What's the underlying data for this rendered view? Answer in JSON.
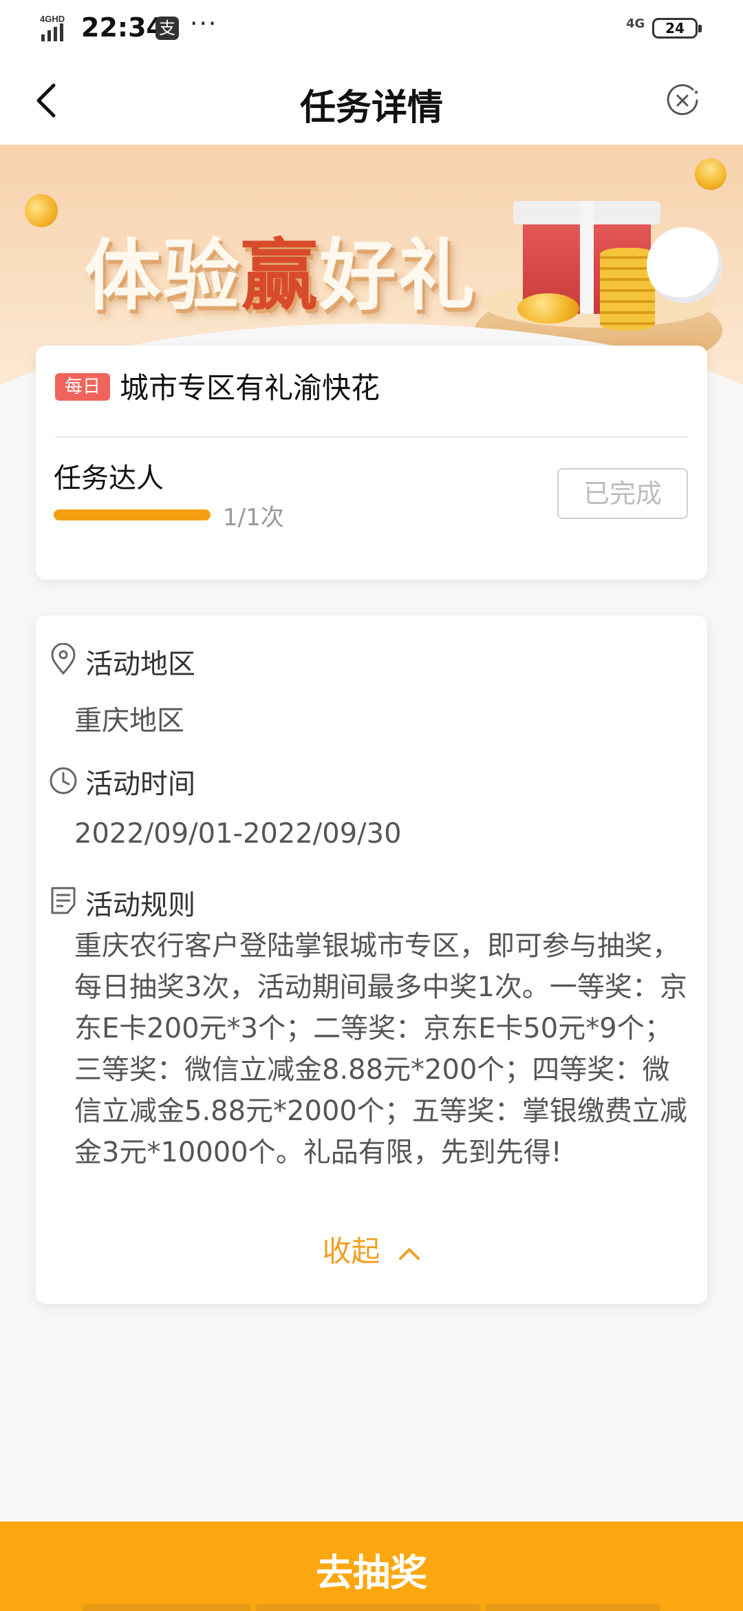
{
  "status_bar": {
    "network_left": "4GHD",
    "time": "22:34",
    "app_icon_glyph": "支",
    "more": "···",
    "network_right": "4G",
    "battery": "24"
  },
  "nav": {
    "title": "任务详情",
    "back_icon": "chevron-left-icon",
    "close_icon": "close-circle-icon"
  },
  "banner": {
    "title_part1": "体验",
    "title_highlight": "赢",
    "title_part2": "好礼"
  },
  "task": {
    "badge": "每日",
    "title": "城市专区有礼渝快花",
    "subtitle": "任务达人",
    "progress_text": "1/1次",
    "progress": 1.0,
    "status_button": "已完成"
  },
  "info": {
    "region_label": "活动地区",
    "region_value": "重庆地区",
    "time_label": "活动时间",
    "time_value": "2022/09/01-2022/09/30",
    "rules_label": "活动规则",
    "rules_text": "重庆农行客户登陆掌银城市专区，即可参与抽奖，每日抽奖3次，活动期间最多中奖1次。一等奖：京东E卡200元*3个；二等奖：京东E卡50元*9个；三等奖：微信立减金8.88元*200个；四等奖：微信立减金5.88元*2000个；五等奖：掌银缴费立减金3元*10000个。礼品有限，先到先得!",
    "collapse_label": "收起"
  },
  "cta": {
    "label": "去抽奖"
  },
  "colors": {
    "accent": "#fca70f",
    "badge": "#f0655b",
    "progress": "#f4a012",
    "highlight_text": "#d94a2b"
  }
}
